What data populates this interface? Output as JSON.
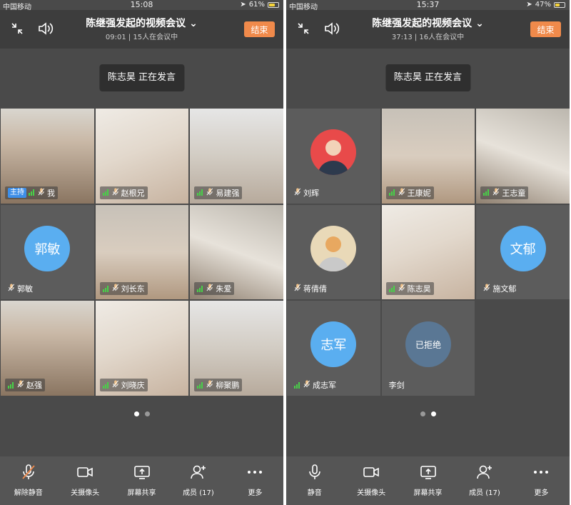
{
  "screens": [
    {
      "status": {
        "carrier": "中国移动",
        "time": "15:08",
        "battery": "61%",
        "battery_level": 0.61
      },
      "header": {
        "title": "陈继强发起的视频会议",
        "subtitle": "09:01 | 15人在会议中",
        "end_label": "结束"
      },
      "speaking": "陈志昊 正在发言",
      "tiles": [
        {
          "name": "我",
          "host_label": "主持",
          "kind": "photo"
        },
        {
          "name": "赵根兄",
          "kind": "photo"
        },
        {
          "name": "易建强",
          "kind": "photo"
        },
        {
          "name": "郭敏",
          "kind": "avatar",
          "avatar_text": "郭敏"
        },
        {
          "name": "刘长东",
          "kind": "photo"
        },
        {
          "name": "朱爱",
          "kind": "photo"
        },
        {
          "name": "赵强",
          "kind": "photo"
        },
        {
          "name": "刘晓庆",
          "kind": "photo"
        },
        {
          "name": "柳聚鹏",
          "kind": "photo"
        }
      ],
      "toolbar": [
        {
          "label": "解除静音",
          "icon": "mic-muted-icon"
        },
        {
          "label": "关摄像头",
          "icon": "camera-icon"
        },
        {
          "label": "屏幕共享",
          "icon": "screen-share-icon"
        },
        {
          "label": "成员 (17)",
          "icon": "add-member-icon"
        },
        {
          "label": "更多",
          "icon": "more-icon"
        }
      ]
    },
    {
      "status": {
        "carrier": "中国移动",
        "time": "15:37",
        "battery": "47%",
        "battery_level": 0.47
      },
      "header": {
        "title": "陈继强发起的视频会议",
        "subtitle": "37:13 | 16人在会议中",
        "end_label": "结束"
      },
      "speaking": "陈志昊 正在发言",
      "tiles": [
        {
          "name": "刘辉",
          "kind": "avatar-photo"
        },
        {
          "name": "王康妮",
          "kind": "photo"
        },
        {
          "name": "王志童",
          "kind": "photo"
        },
        {
          "name": "蒋倩倩",
          "kind": "avatar-photo"
        },
        {
          "name": "陈志昊",
          "kind": "photo",
          "active": true
        },
        {
          "name": "施文郁",
          "kind": "avatar",
          "avatar_text": "文郁"
        },
        {
          "name": "成志军",
          "kind": "avatar",
          "avatar_text": "志军"
        },
        {
          "name": "李剑",
          "kind": "avatar-slate",
          "avatar_text": "已拒绝"
        },
        {
          "kind": "empty"
        }
      ],
      "toolbar": [
        {
          "label": "静音",
          "icon": "mic-icon"
        },
        {
          "label": "关摄像头",
          "icon": "camera-icon"
        },
        {
          "label": "屏幕共享",
          "icon": "screen-share-icon"
        },
        {
          "label": "成员 (17)",
          "icon": "add-member-icon"
        },
        {
          "label": "更多",
          "icon": "more-icon"
        }
      ]
    }
  ],
  "colors": {
    "accent": "#f08a4b",
    "host": "#3d8ee8",
    "signal": "#48d148",
    "avatar_blue": "#5aaef0"
  }
}
